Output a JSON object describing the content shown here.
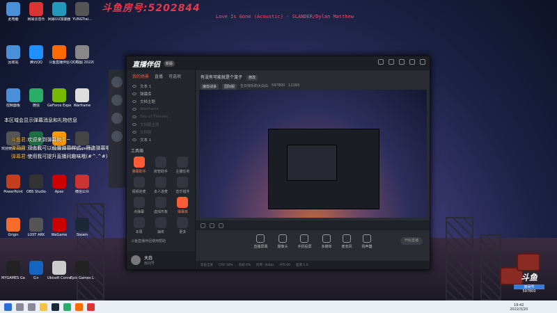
{
  "watermark": "斗鱼房号:5202844",
  "now_playing": "Love Is Gone (Acoustic) - SLANDER/Dylan Matthew",
  "desktop_icons": [
    {
      "label": "此电脑",
      "color": "#4a90d9"
    },
    {
      "label": "网易云音乐",
      "color": "#d33"
    },
    {
      "label": "网易UU加速器",
      "color": "#29b"
    },
    {
      "label": "YUNGTrai...",
      "color": "#555"
    },
    {
      "label": "回收站",
      "color": "#4a90d9"
    },
    {
      "label": "腾讯QQ",
      "color": "#1e90ff"
    },
    {
      "label": "斗鱼直播伴侣",
      "color": "#ff6a00"
    },
    {
      "label": "QQ截图 20220315...",
      "color": "#888"
    },
    {
      "label": "控制面板",
      "color": "#4a90d9"
    },
    {
      "label": "微信",
      "color": "#2aae67"
    },
    {
      "label": "GeForce Experience",
      "color": "#76b900"
    },
    {
      "label": "Warframe",
      "color": "#ddd"
    },
    {
      "label": "欢迎使用斗鱼弹幕助手",
      "color": "#555"
    },
    {
      "label": "EXCEL",
      "color": "#1d7044"
    },
    {
      "label": "Bandizip",
      "color": "#ff9800"
    },
    {
      "label": "Wallpaper Engine",
      "color": "#444"
    },
    {
      "label": "PowerPoint",
      "color": "#c43e1c"
    },
    {
      "label": "OBS Studio",
      "color": "#333"
    },
    {
      "label": "Apex",
      "color": "#c00"
    },
    {
      "label": "微信公众",
      "color": "#c33"
    },
    {
      "label": "Origin",
      "color": "#f56c2d"
    },
    {
      "label": "LOST ARK",
      "color": "#555"
    },
    {
      "label": "WeGame",
      "color": "#c00"
    },
    {
      "label": "Steam",
      "color": "#1b2838"
    },
    {
      "label": "MYGAMES GameCenter",
      "color": "#222"
    },
    {
      "label": "G+",
      "color": "#1565c0"
    },
    {
      "label": "Ubisoft Connect",
      "color": "#ccc"
    },
    {
      "label": "Epic Games Launcher",
      "color": "#222"
    }
  ],
  "chat": {
    "notice": "本区域会显示弹幕消息和礼物信息",
    "messages": [
      {
        "name": "斗鱼君:",
        "text": "欢迎来到弹幕助手~"
      },
      {
        "name": "弹幕君:",
        "text": "双击我可以设置弹幕样式、筛选弹幕哦~"
      },
      {
        "name": "弹幕君:",
        "text": "使用我可提升直播间趣味哦(#^.^#)"
      }
    ]
  },
  "app": {
    "logo": "直播伴侣",
    "version": "新版",
    "tabs": [
      "我的场景",
      "直播",
      "可选项"
    ],
    "scenes": [
      {
        "label": "文本 1",
        "dim": false
      },
      {
        "label": "弹幕库",
        "dim": false
      },
      {
        "label": "文档主题",
        "dim": false
      },
      {
        "label": "Warframe",
        "dim": true
      },
      {
        "label": "Sea of Thieves",
        "dim": true
      },
      {
        "label": "文档版主题",
        "dim": true
      },
      {
        "label": "文档版",
        "dim": true
      },
      {
        "label": "文本 1",
        "dim": false
      }
    ],
    "tools_title": "工具箱",
    "tools": [
      {
        "label": "弹幕助手",
        "hot": true
      },
      {
        "label": "房管助手",
        "hot": false
      },
      {
        "label": "主播任务",
        "hot": false
      },
      {
        "label": "视频连麦",
        "hot": false
      },
      {
        "label": "多人连麦",
        "hot": false
      },
      {
        "label": "音乐插件",
        "hot": false
      },
      {
        "label": "点弹幕",
        "hot": false
      },
      {
        "label": "虚拟形象",
        "hot": false
      },
      {
        "label": "弹幕库",
        "hot": true
      },
      {
        "label": "本周",
        "hot": false
      },
      {
        "label": "抽奖",
        "hot": false
      },
      {
        "label": "更多",
        "hot": false
      }
    ],
    "footer_tip": "斗鱼直播伴侣使用帮助",
    "user": {
      "name": "大白",
      "id": "房间号"
    },
    "room_title": "有没有可能就是个笼子",
    "room_edit": "修改",
    "room_meta": [
      "魔兽战争",
      "国际服",
      "生日快乐的大白白",
      "597800",
      "11193"
    ],
    "sources": [
      "直播屏幕",
      "摄像头",
      "手机投屏",
      "多媒体",
      "麦克风",
      "扬声器"
    ],
    "start_label": "开始直播",
    "status": [
      "双击全屏",
      "CPU 10%",
      "丢帧 0%",
      "码率: 0kbps",
      "FPS 60",
      "超清 1.0"
    ]
  },
  "overlay_brand": {
    "name": "斗鱼",
    "room_label": "房间号",
    "room": "597800"
  },
  "clock": {
    "time": "19:42",
    "date": "2022/3/20"
  }
}
